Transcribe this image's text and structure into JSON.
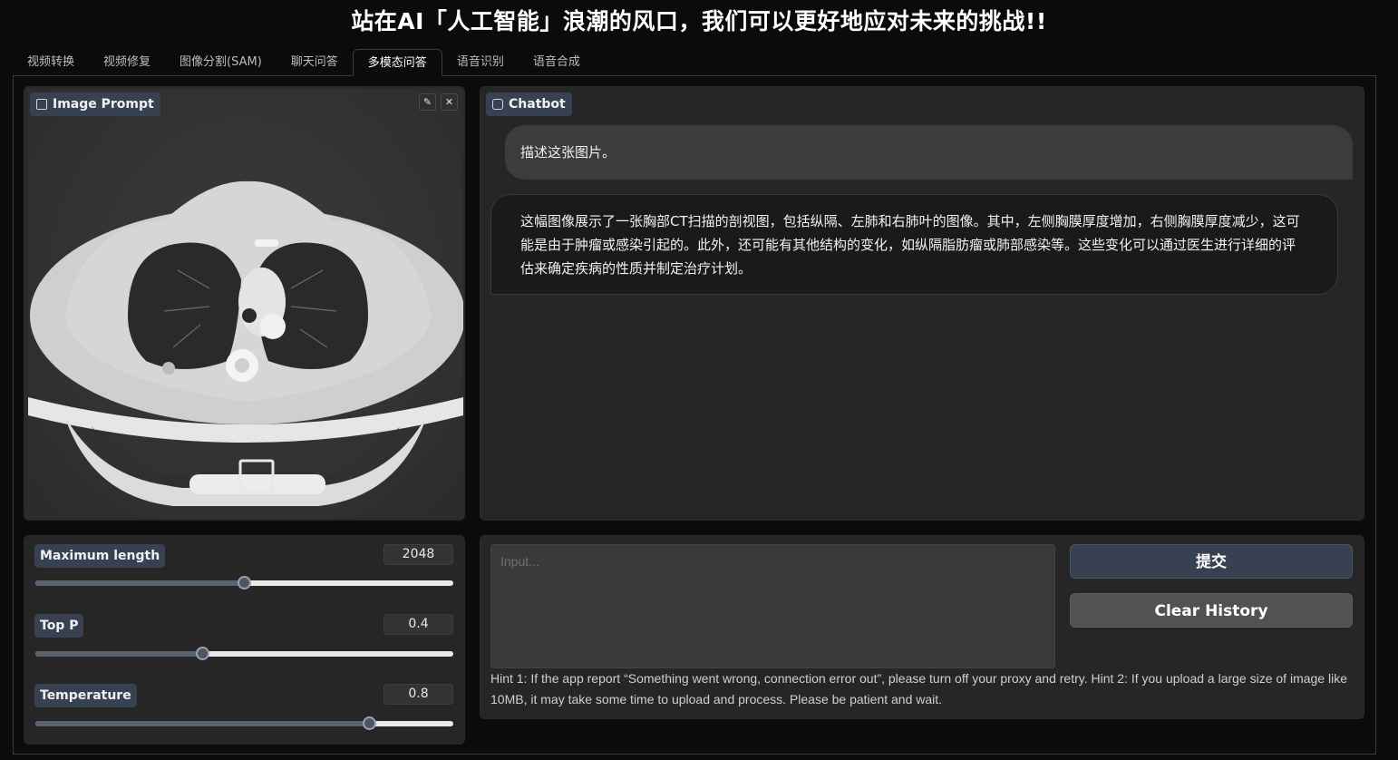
{
  "header": {
    "title": "站在AI「人工智能」浪潮的风口，我们可以更好地应对未来的挑战!!"
  },
  "tabs": [
    {
      "label": "视频转换",
      "active": false
    },
    {
      "label": "视频修复",
      "active": false
    },
    {
      "label": "图像分割(SAM)",
      "active": false
    },
    {
      "label": "聊天问答",
      "active": false
    },
    {
      "label": "多模态问答",
      "active": true
    },
    {
      "label": "语音识别",
      "active": false
    },
    {
      "label": "语音合成",
      "active": false
    }
  ],
  "image_prompt": {
    "label": "Image Prompt",
    "image": "chest-ct-scan-image"
  },
  "chatbot": {
    "label": "Chatbot",
    "messages": [
      {
        "role": "user",
        "text": "描述这张图片。"
      },
      {
        "role": "bot",
        "text": "这幅图像展示了一张胸部CT扫描的剖视图，包括纵隔、左肺和右肺叶的图像。其中，左侧胸膜厚度增加，右侧胸膜厚度减少，这可能是由于肿瘤或感染引起的。此外，还可能有其他结构的变化，如纵隔脂肪瘤或肺部感染等。这些变化可以通过医生进行详细的评估来确定疾病的性质并制定治疗计划。"
      }
    ]
  },
  "params": {
    "max_length": {
      "label": "Maximum length",
      "value": "2048",
      "fraction": 0.5
    },
    "top_p": {
      "label": "Top P",
      "value": "0.4",
      "fraction": 0.4
    },
    "temperature": {
      "label": "Temperature",
      "value": "0.8",
      "fraction": 0.8
    }
  },
  "input": {
    "placeholder": "Input...",
    "value": ""
  },
  "buttons": {
    "submit": "提交",
    "clear": "Clear History"
  },
  "hint": "Hint 1: If the app report “Something went wrong, connection error out”, please turn off your proxy and retry. Hint 2: If you upload a large size of image like 10MB, it may take some time to upload and process. Please be patient and wait.",
  "colors": {
    "accent": "#374151",
    "background": "#0b0b0b",
    "panel": "#262626"
  }
}
